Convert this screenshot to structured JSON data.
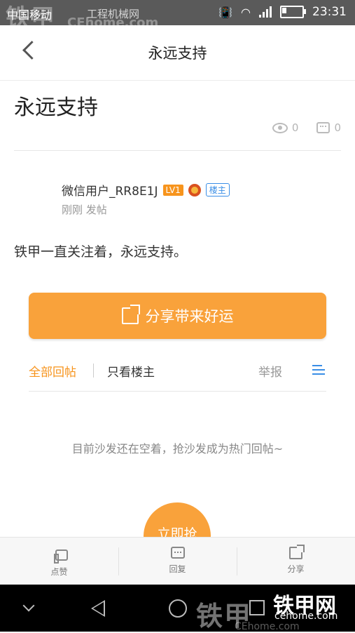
{
  "status_bar": {
    "carrier": "中国移动",
    "time": "23:31",
    "watermark_logo": "铁甲",
    "watermark_domain": "CEhome.com",
    "watermark_text": "工程机械网"
  },
  "header": {
    "title": "永远支持"
  },
  "post": {
    "title": "永远支持",
    "views": "0",
    "comments": "0",
    "author": "微信用户_RR8E1J",
    "level": "LV1",
    "owner_badge": "楼主",
    "time": "刚刚 发帖",
    "content": "铁甲一直关注着，永远支持。"
  },
  "share_button": {
    "label": "分享带来好运"
  },
  "tabs": {
    "all": "全部回帖",
    "owner_only": "只看楼主",
    "report": "举报"
  },
  "empty_message": "目前沙发还在空着，抢沙发成为热门回帖~",
  "sofa_button": {
    "label": "立即抢"
  },
  "bottom_bar": {
    "like": "点赞",
    "reply": "回复",
    "share": "分享"
  },
  "navbar_watermark": {
    "logo": "铁甲",
    "logo_small": "铁甲网",
    "domain": "cehome.com"
  },
  "colors": {
    "accent": "#f9a23b",
    "tab_active": "#f7941d",
    "badge_blue": "#3a8ee6"
  }
}
